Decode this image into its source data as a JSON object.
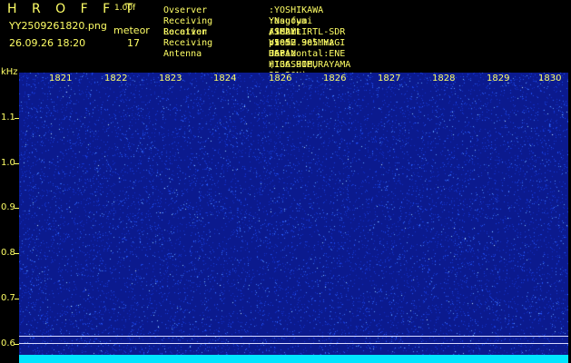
{
  "header": {
    "brand": "H R O F F T",
    "version": "1.00f",
    "filename": "YY2509261820.png",
    "mode_label": "meteor",
    "datetime": "26.09.26 18:20",
    "count": "17"
  },
  "info": [
    {
      "label": "Ovserver",
      "value": ":YOSHIKAWA Yasufumi /JG2MLI"
    },
    {
      "label": "Receiving Location",
      "value": ":Nagoya Aichi-pref. JAPAN (136.90E, 35.20N)"
    },
    {
      "label": "Receiver",
      "value": ":SMArt RTL-SDR V5 52.905MHz USB HIGASHIMURAYAMA"
    },
    {
      "label": "Receiving Antenna",
      "value": ":10mH 3el.YAGI Horizontal:ENE"
    }
  ],
  "y_axis": {
    "unit": "kHz",
    "labels": [
      "1.1",
      "1.0",
      "0.9",
      "0.8",
      "0.7",
      "0.6"
    ]
  },
  "time_axis": {
    "labels": [
      "1821",
      "1822",
      "1823",
      "1824",
      "1826",
      "1826",
      "1827",
      "1828",
      "1829",
      "1830"
    ]
  },
  "colors": {
    "text": "#ffff66",
    "background": "#000000",
    "spectrogram": "#0b1a8e",
    "baseline": "#00e5ff"
  }
}
